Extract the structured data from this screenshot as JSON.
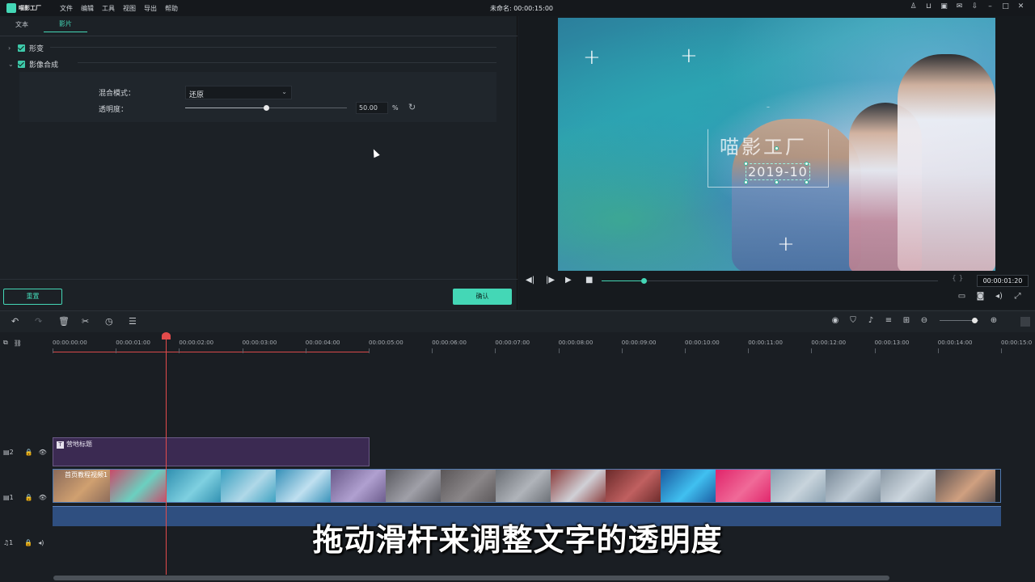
{
  "app": {
    "logo_text": "喵影工厂",
    "menu": [
      "文件",
      "编辑",
      "工具",
      "视图",
      "导出",
      "帮助"
    ],
    "project_title": "未命名: 00:00:15:00",
    "window_icons": [
      "user-icon",
      "cart-icon",
      "save-icon",
      "mail-icon",
      "download-icon",
      "minimize-icon",
      "maximize-icon",
      "close-icon"
    ]
  },
  "left_panel": {
    "tabs": [
      "文本",
      "影片"
    ],
    "active_tab": "影片",
    "sections": [
      {
        "label": "形变",
        "expanded": false,
        "checked": true
      },
      {
        "label": "影像合成",
        "expanded": true,
        "checked": true
      }
    ],
    "blend_mode": {
      "label": "混合模式：",
      "value": "还原"
    },
    "opacity": {
      "label": "透明度：",
      "value": "50.00",
      "unit": "%",
      "fraction": 0.5
    },
    "reset_button": "重置",
    "ok_button": "确认"
  },
  "preview": {
    "watermark_text": "喵影工厂",
    "watermark_year": "2019-10",
    "timecode": "00:00:01:20",
    "progress_fraction": 0.125,
    "bracket": "{ }"
  },
  "timeline": {
    "ticks": [
      "00:00:00:00",
      "00:00:01:00",
      "00:00:02:00",
      "00:00:03:00",
      "00:00:04:00",
      "00:00:05:00",
      "00:00:06:00",
      "00:00:07:00",
      "00:00:08:00",
      "00:00:09:00",
      "00:00:10:00",
      "00:00:11:00",
      "00:00:12:00",
      "00:00:13:00",
      "00:00:14:00",
      "00:00:15:0"
    ],
    "tracks": [
      {
        "index": "2",
        "type": "title"
      },
      {
        "index": "1",
        "type": "video"
      },
      {
        "index": "1",
        "type": "audio"
      }
    ],
    "title_clip": "营地标题",
    "video_clip": "首页教程视频1"
  },
  "subtitle": "拖动滑杆来调整文字的透明度",
  "colors": {
    "accent": "#44d7b6",
    "playhead": "#e24b4b",
    "title_clip": "#3b2a52",
    "video_clip_border": "#4e79b0"
  }
}
